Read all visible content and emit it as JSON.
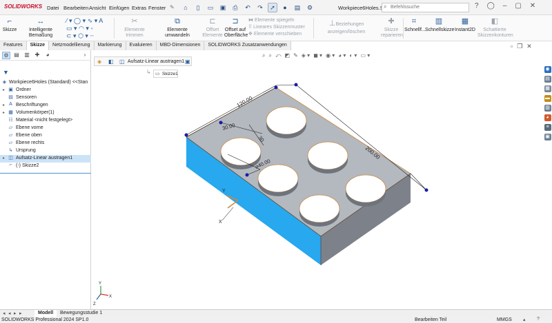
{
  "app": {
    "logo": "SOLIDWORKS",
    "doc_title": "Workpiece6Holes.S...",
    "search_placeholder": "Befehlssuche"
  },
  "menu": [
    "Datei",
    "Bearbeiten",
    "Ansicht",
    "Einfügen",
    "Extras",
    "Fenster"
  ],
  "ribbon": {
    "sketch": "Skizze",
    "smart_dim": "Intelligente Bemaßung",
    "trim": "Elemente trimmen",
    "convert": "Elemente umwandeln",
    "offset": "Offset Elemente",
    "offset_surface": "Offset auf Oberfläche",
    "mirror": "Elemente spiegeln",
    "linear_pattern": "Lineares Skizzenmuster",
    "move": "Elemente verschieben",
    "relations": "Beziehungen anzeigen/löschen",
    "repair": "Skizze reparieren",
    "quick": "Schnellf...",
    "quick_sketch": "Schnellskizze",
    "instant2d": "Instant2D",
    "shaded": "Schattierte Skizzenkonturen"
  },
  "tabs": [
    "Features",
    "Skizze",
    "Netzmodellierung",
    "Markierung",
    "Evaluieren",
    "MBD-Dimensionen",
    "SOLIDWORKS Zusatzanwendungen"
  ],
  "active_tab": "Skizze",
  "tree": [
    {
      "label": "Workpiece6Holes (Standard) <<Stan",
      "icon": "part-icon",
      "level": 0,
      "arrow": ""
    },
    {
      "label": "Ordner",
      "icon": "folder-icon",
      "level": 1,
      "arrow": "▸"
    },
    {
      "label": "Sensoren",
      "icon": "sensor-icon",
      "level": 1,
      "arrow": ""
    },
    {
      "label": "Beschriftungen",
      "icon": "annotation-icon",
      "level": 1,
      "arrow": "▸"
    },
    {
      "label": "Volumenkörper(1)",
      "icon": "solid-body-icon",
      "level": 1,
      "arrow": "▸"
    },
    {
      "label": "Material <nicht festgelegt>",
      "icon": "material-icon",
      "level": 1,
      "arrow": ""
    },
    {
      "label": "Ebene vorne",
      "icon": "plane-icon",
      "level": 1,
      "arrow": ""
    },
    {
      "label": "Ebene oben",
      "icon": "plane-icon",
      "level": 1,
      "arrow": ""
    },
    {
      "label": "Ebene rechts",
      "icon": "plane-icon",
      "level": 1,
      "arrow": ""
    },
    {
      "label": "Ursprung",
      "icon": "origin-icon",
      "level": 1,
      "arrow": ""
    },
    {
      "label": "Aufsatz-Linear austragen1",
      "icon": "extrude-icon",
      "level": 1,
      "arrow": "▸",
      "selected": true
    },
    {
      "label": "(-) Skizze2",
      "icon": "sketch-icon",
      "level": 1,
      "arrow": ""
    }
  ],
  "breadcrumb": {
    "feature": "Aufsatz-Linear austragen1",
    "sketch": "Skizze1"
  },
  "dims": {
    "len": "200.00",
    "wid": "120.00",
    "hole_x": "30.00",
    "hole_y": "30",
    "dia": "⌀40.00"
  },
  "axes": {
    "x": "X",
    "y": "Y",
    "z": "Z"
  },
  "bottom_tabs": [
    "Modell",
    "Bewegungsstudie 1"
  ],
  "status": {
    "left": "SOLIDWORKS Professional 2024 SP1.0",
    "mode": "Bearbeiten Teil",
    "units": "MMGS"
  },
  "colors": {
    "accent": "#2b5d9c",
    "brand": "#c8102e",
    "face_top": "#b4b8bf",
    "face_side": "#27a8ef",
    "face_front": "#7d818a"
  }
}
